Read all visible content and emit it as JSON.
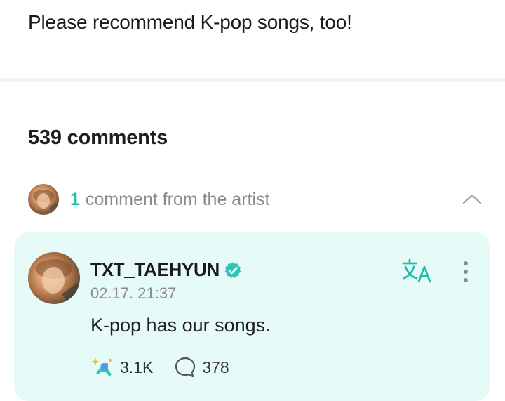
{
  "post": {
    "text": "Please recommend K-pop songs, too!"
  },
  "comments": {
    "count_label": "539 comments",
    "artist_section": {
      "count": "1",
      "label": "comment from the artist"
    }
  },
  "artist_comment": {
    "author": "TXT_TAEHYUN",
    "timestamp": "02.17. 21:37",
    "text": "K-pop has our songs.",
    "likes": "3.1K",
    "replies": "378",
    "icons": [
      "verified-badge-icon",
      "translate-icon",
      "more-options-icon",
      "reaction-icon",
      "reply-bubble-icon",
      "chevron-up-icon"
    ]
  },
  "colors": {
    "accent": "#1fbfb0",
    "card_bg": "#e6fbf7",
    "muted": "#8a8a8a"
  }
}
